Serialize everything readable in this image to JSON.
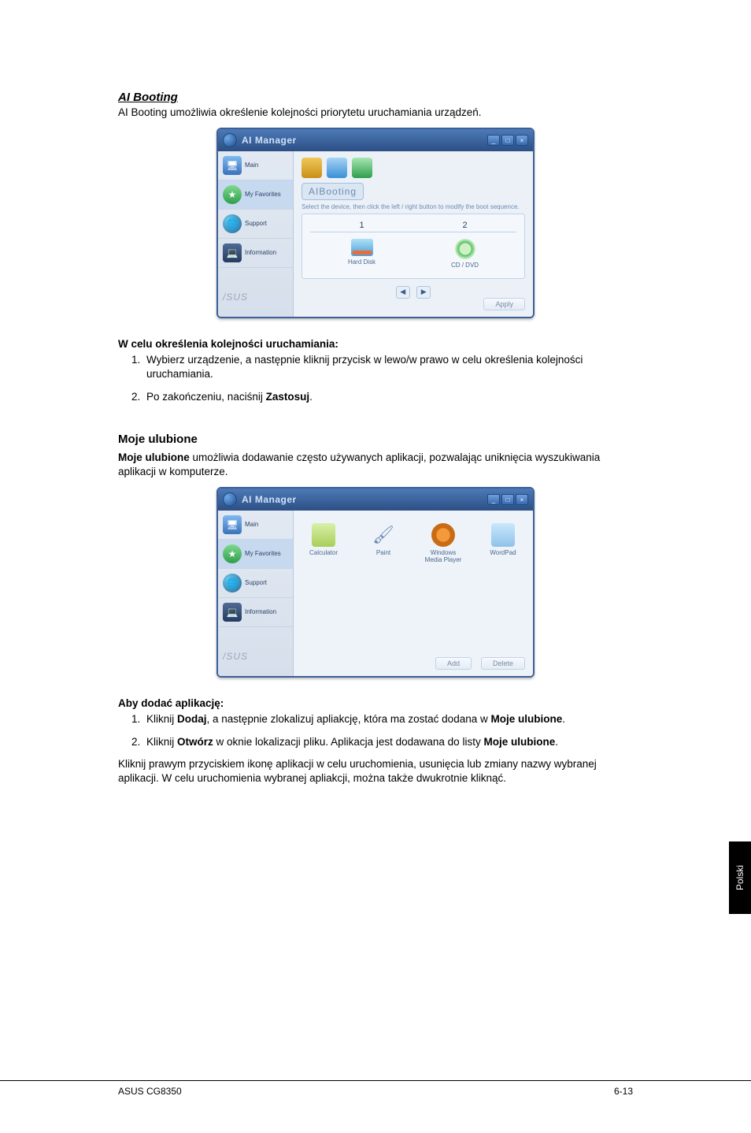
{
  "section1": {
    "title": "AI Booting",
    "intro": "AI Booting umożliwia określenie kolejności priorytetu uruchamiania urządzeń."
  },
  "appwin1": {
    "title": "AI Manager",
    "sidebar": {
      "main": "Main",
      "fav": "My Favorites",
      "support": "Support",
      "info": "Information"
    },
    "brand": "/SUS",
    "pane_title": "AIBooting",
    "hint": "Select the device, then click the left / right button to modify the boot sequence.",
    "col1": "1",
    "col2": "2",
    "dev1": "Hard Disk",
    "dev2": "CD / DVD",
    "apply": "Apply"
  },
  "bootorder": {
    "heading": "W celu określenia kolejności uruchamiania:",
    "step1": "Wybierz urządzenie, a następnie kliknij przycisk w lewo/w prawo w celu określenia kolejności uruchamiania.",
    "step2_a": "Po zakończeniu, naciśnij ",
    "step2_b": "Zastosuj",
    "step2_c": "."
  },
  "section2": {
    "title": "Moje ulubione",
    "intro_bold": "Moje ulubione",
    "intro_rest": " umożliwia dodawanie często używanych aplikacji, pozwalając uniknięcia wyszukiwania aplikacji w komputerze."
  },
  "appwin2": {
    "title": "AI Manager",
    "sidebar": {
      "main": "Main",
      "fav": "My Favorites",
      "support": "Support",
      "info": "Information"
    },
    "brand": "/SUS",
    "items": {
      "calc": "Calculator",
      "paint": "Paint",
      "media": "Windows Media Player",
      "wpad": "WordPad"
    },
    "add": "Add",
    "delete": "Delete"
  },
  "addapp": {
    "heading": "Aby dodać aplikację:",
    "s1a": "Kliknij ",
    "s1b": "Dodaj",
    "s1c": ", a następnie zlokalizuj apliakcję, która ma zostać dodana w ",
    "s1d": "Moje ulubione",
    "s1e": ".",
    "s2a": "Kliknij ",
    "s2b": "Otwórz",
    "s2c": " w oknie lokalizacji pliku. Aplikacja jest dodawana do listy ",
    "s2d": "Moje ulubione",
    "s2e": "."
  },
  "closing": "Kliknij prawym przyciskiem ikonę aplikacji w celu uruchomienia, usunięcia lub zmiany nazwy wybranej aplikacji. W celu uruchomienia wybranej apliakcji, można także dwukrotnie kliknąć.",
  "sidetab": "Polski",
  "footer_left": "ASUS CG8350",
  "footer_right": "6-13"
}
